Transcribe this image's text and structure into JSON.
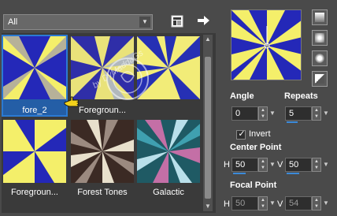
{
  "category_dropdown": {
    "value": "All"
  },
  "gradients": [
    {
      "label": "fore_2",
      "selected": true
    },
    {
      "label": "Foregroun..."
    },
    {
      "label": ""
    },
    {
      "label": "Foregroun..."
    },
    {
      "label": "Forest Tones"
    },
    {
      "label": "Galactic"
    }
  ],
  "watermark_text": "by DyMaddaGs",
  "angle": {
    "label": "Angle",
    "value": "0"
  },
  "repeats": {
    "label": "Repeats",
    "value": "5"
  },
  "invert": {
    "label": "Invert",
    "checked": true
  },
  "center_point": {
    "label": "Center Point",
    "h_label": "H",
    "h_value": "50",
    "v_label": "V",
    "v_value": "50"
  },
  "focal_point": {
    "label": "Focal Point",
    "h_label": "H",
    "h_value": "50",
    "v_label": "V",
    "v_value": "54"
  },
  "colors": {
    "accent": "#2b7ad3",
    "blue": "#2428b8",
    "yellow": "#f4ef6a"
  }
}
